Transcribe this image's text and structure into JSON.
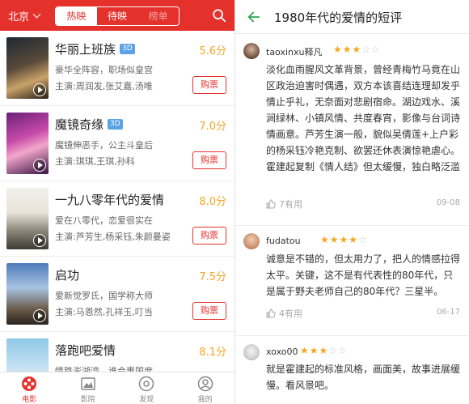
{
  "left": {
    "city": "北京",
    "tabs": [
      "热映",
      "待映",
      "榜单"
    ],
    "movies": [
      {
        "title": "华丽上班族",
        "badge": "3D",
        "score": "5.6分",
        "desc": "豪华全阵容，职场似皇宫",
        "cast": "主演:周润发,张艾嘉,汤唯",
        "buy": "购票"
      },
      {
        "title": "魔镜奇缘",
        "badge": "3D",
        "score": "7.0分",
        "desc": "魔镜伸恶手，公主斗皇后",
        "cast": "主演:琪琪,王琪,孙科",
        "buy": "购票"
      },
      {
        "title": "一九八零年代的爱情",
        "badge": "",
        "score": "8.0分",
        "desc": "爱在八零代，恋爱很实在",
        "cast": "主演:芦芳生,杨采钰,朱颜曼姿",
        "buy": "购票"
      },
      {
        "title": "启功",
        "badge": "",
        "score": "7.5分",
        "desc": "爱新觉罗氏，国学称大师",
        "cast": "主演:马恩然,孔祥玉,叮当",
        "buy": "购票"
      },
      {
        "title": "落跑吧爱情",
        "badge": "",
        "score": "8.1分",
        "desc": "情路澎湖湾，谁会惠国度",
        "cast": "",
        "buy": ""
      }
    ],
    "tabbar": [
      "电影",
      "影院",
      "发现",
      "我的"
    ]
  },
  "right": {
    "title": "1980年代的爱情的短评",
    "reviews": [
      {
        "user": "taoxinxu释凡",
        "stars": 3,
        "text": "淡化血雨腥风文革背景，曾经青梅竹马竟在山区政治迫害时偶遇，双方本该喜结连理却发乎情止乎礼，无奈面对悲剧宿命。湖边戏水、溪涧绿林、小镇风情、共度春宵，影像与台词诗情画意。芦芳生演一般，貌似吴倩莲+上户彩的杨采钰冷艳克制、欲罢还休表演惊艳虐心。霍建起复制《情人结》但太缓慢，独白略泛滥",
        "useful": "7有用",
        "date": "09-08"
      },
      {
        "user": "fudatou",
        "stars": 4,
        "text": "诚意是不错的，但太用力了，把人的情感拉得太平。关键，这不是有代表性的80年代，只是属于野夫老师自己的80年代？三星半。",
        "useful": "4有用",
        "date": "06-17"
      },
      {
        "user": "xoxo00",
        "stars": 3,
        "text": "就是霍建起的标准风格，画面美，故事进展缓慢。看风景吧。",
        "useful": "",
        "date": ""
      }
    ]
  },
  "colors": {
    "accent": "#e5312c",
    "score": "#f5a623",
    "back_arrow": "#2ea44f"
  }
}
